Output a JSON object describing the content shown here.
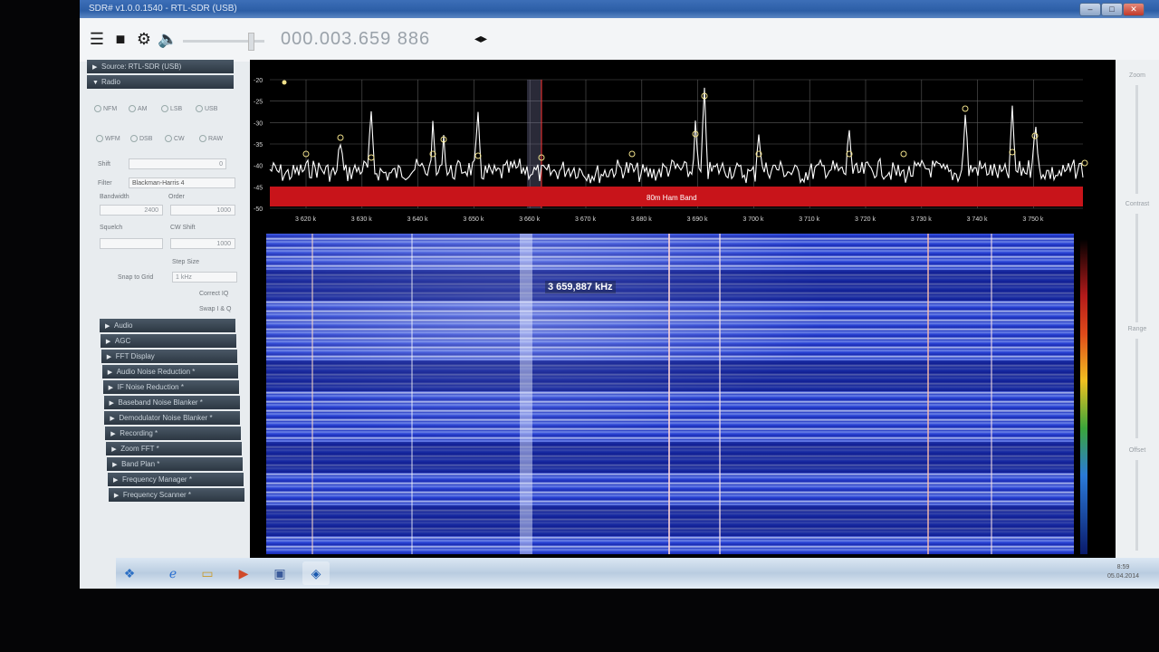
{
  "window": {
    "title": "SDR# v1.0.0.1540 - RTL-SDR (USB)"
  },
  "toolbar": {
    "menu_icon": "hamburger-menu-icon",
    "stop_icon": "stop-icon",
    "settings_icon": "gear-icon",
    "volume_icon": "speaker-icon",
    "frequency": "000.003.659 886",
    "tune_arrows": "◂▸"
  },
  "sidebar": {
    "source_header": "Source: RTL-SDR (USB)",
    "radio_header": "Radio",
    "modes_row1": [
      "NFM",
      "AM",
      "LSB",
      "USB"
    ],
    "modes_row2": [
      "WFM",
      "DSB",
      "CW",
      "RAW"
    ],
    "shift_label": "Shift",
    "shift_value": "0",
    "filter_label": "Filter",
    "filter_value": "Blackman-Harris 4",
    "bandwidth_label": "Bandwidth",
    "bandwidth_value": "2400",
    "order_label": "Order",
    "order_value": "1000",
    "squelch_label": "Squelch",
    "cw_shift_label": "CW Shift",
    "cw_shift_value": "1000",
    "step_size_label": "Step Size",
    "snap_label": "Snap to Grid",
    "snap_value": "1 kHz",
    "correct_iq": "Correct IQ",
    "swap_iq": "Swap I & Q",
    "panels": [
      "Audio",
      "AGC",
      "FFT Display",
      "Audio Noise Reduction *",
      "IF Noise Reduction *",
      "Baseband Noise Blanker *",
      "Demodulator Noise Blanker *",
      "Recording *",
      "Zoom FFT *",
      "Band Plan *",
      "Frequency Manager *",
      "Frequency Scanner *"
    ]
  },
  "spectrum": {
    "band_label": "80m Ham Band",
    "y_ticks": [
      "-20",
      "-25",
      "-30",
      "-35",
      "-40",
      "-45",
      "-50"
    ],
    "x_ticks": [
      "3 620 k",
      "3 630 k",
      "3 640 k",
      "3 650 k",
      "3 660 k",
      "3 670 k",
      "3 680 k",
      "3 690 k",
      "3 700 k",
      "3 710 k",
      "3 720 k",
      "3 730 k",
      "3 740 k",
      "3 750 k"
    ],
    "cursor_readout": "3 659,887 kHz",
    "colors": {
      "band": "#c8141a",
      "trace": "#ffffff",
      "grid": "#5a5a5a",
      "waterfall": "#2238c8"
    }
  },
  "right_panel": {
    "zoom": "Zoom",
    "contrast": "Contrast",
    "range": "Range",
    "offset": "Offset"
  },
  "taskbar": {
    "apps": [
      "windows-start-icon",
      "internet-explorer-icon",
      "folder-icon",
      "media-icon",
      "floppy-icon",
      "sdr-app-icon"
    ],
    "time": "8:59",
    "date": "05.04.2014"
  }
}
